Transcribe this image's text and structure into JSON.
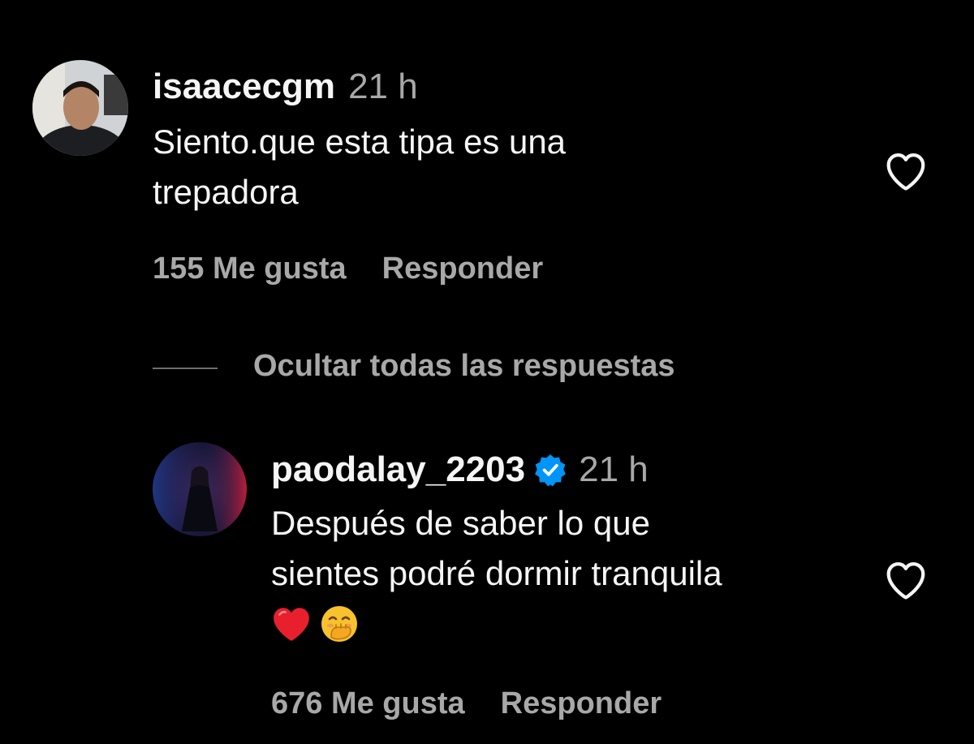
{
  "comments": [
    {
      "username": "isaacecgm",
      "time": "21 h",
      "text_lines": [
        "Siento.que esta tipa es una",
        "trepadora"
      ],
      "likes": "155 Me gusta",
      "reply_label": "Responder",
      "verified": false
    },
    {
      "username": "paodalay_2203",
      "time": "21 h",
      "text_lines": [
        "Después de saber lo que",
        "sientes podré dormir tranquila"
      ],
      "emojis": [
        "red-heart",
        "face-with-hand-over-mouth"
      ],
      "likes": "676 Me gusta",
      "reply_label": "Responder",
      "verified": true
    }
  ],
  "hide_replies_label": "Ocultar todas las respuestas",
  "colors": {
    "background": "#000000",
    "primary_text": "#f5f5f5",
    "secondary_text": "#a8a8a8",
    "verified_blue": "#0095f6"
  }
}
